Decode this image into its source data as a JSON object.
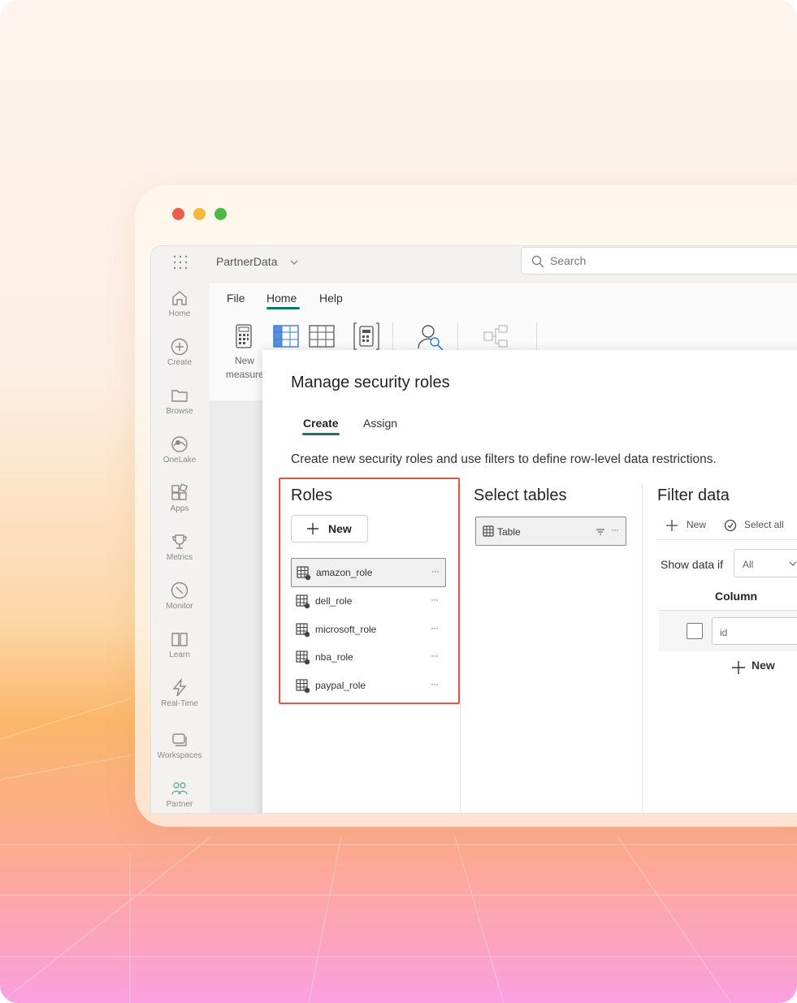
{
  "workspace": {
    "name": "PartnerData"
  },
  "search": {
    "placeholder": "Search"
  },
  "nav": {
    "items": [
      {
        "label": "Home",
        "icon": "home-icon"
      },
      {
        "label": "Create",
        "icon": "plus-circle-icon"
      },
      {
        "label": "Browse",
        "icon": "folder-icon"
      },
      {
        "label": "OneLake",
        "icon": "onelake-icon"
      },
      {
        "label": "Apps",
        "icon": "apps-icon"
      },
      {
        "label": "Metrics",
        "icon": "trophy-icon"
      },
      {
        "label": "Monitor",
        "icon": "monitor-icon"
      },
      {
        "label": "Learn",
        "icon": "book-icon"
      },
      {
        "label": "Real-Time",
        "icon": "lightning-icon"
      },
      {
        "label": "Workspaces",
        "icon": "workspaces-icon"
      },
      {
        "label": "Partner",
        "icon": "partner-icon"
      }
    ]
  },
  "ribbon": {
    "tabs": [
      "File",
      "Home",
      "Help"
    ],
    "active_tab": "Home",
    "new_measure_label": "New",
    "new_measure_label2": "measure"
  },
  "dialog": {
    "title": "Manage security roles",
    "tabs": [
      "Create",
      "Assign"
    ],
    "active_tab": "Create",
    "description": "Create new security roles and use filters to define row-level data restrictions.",
    "roles": {
      "heading": "Roles",
      "new_label": "New",
      "items": [
        {
          "name": "amazon_role",
          "selected": true
        },
        {
          "name": "dell_role",
          "selected": false
        },
        {
          "name": "microsoft_role",
          "selected": false
        },
        {
          "name": "nba_role",
          "selected": false
        },
        {
          "name": "paypal_role",
          "selected": false
        }
      ],
      "more": "···"
    },
    "tables": {
      "heading": "Select tables",
      "items": [
        {
          "name": "Table"
        }
      ]
    },
    "filter": {
      "heading": "Filter data",
      "new_label": "New",
      "select_all_label": "Select all",
      "show_data_if_label": "Show data if",
      "show_data_if_value": "All",
      "column_header": "Column",
      "rows": [
        {
          "value": "id",
          "checked": false
        }
      ],
      "add_new_label": "New"
    }
  },
  "colors": {
    "accent": "#117865",
    "highlight_border": "#e8543c",
    "traffic_red": "#ee5c50",
    "traffic_yellow": "#f5b83d",
    "traffic_green": "#4cb845"
  }
}
